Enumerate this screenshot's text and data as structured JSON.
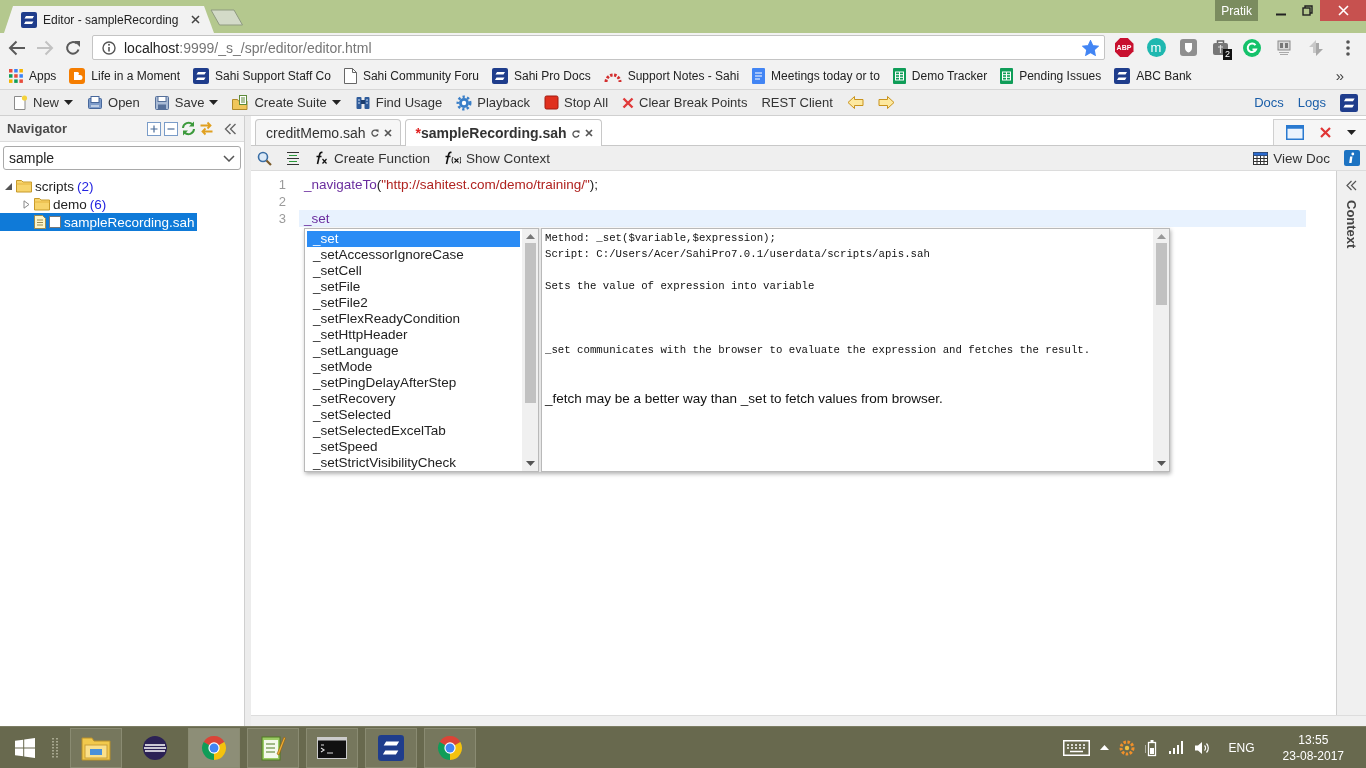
{
  "browser": {
    "tabs": [
      {
        "title": "Editor - sampleRecording",
        "selected": true
      }
    ],
    "profile_name": "Pratik",
    "nav_buttons": [
      {
        "kind": "back",
        "disabled": false
      },
      {
        "kind": "forward",
        "disabled": true
      },
      {
        "kind": "reload",
        "disabled": false
      }
    ],
    "address": {
      "host": "localhost",
      "rest": ":9999/_s_/spr/editor/editor.html",
      "bookmarked": true
    },
    "extensions": [
      {
        "kind": "stop-sign",
        "label": "ABP"
      },
      {
        "kind": "circle",
        "label": "m"
      },
      {
        "kind": "shield"
      },
      {
        "kind": "briefcase",
        "badge": "2"
      },
      {
        "kind": "g-circle"
      },
      {
        "kind": "box"
      },
      {
        "kind": "arrows"
      },
      {
        "kind": "menu"
      }
    ],
    "bookmarks": [
      {
        "kind": "apps",
        "label": "Apps"
      },
      {
        "kind": "blog",
        "label": "Life in a Moment"
      },
      {
        "kind": "logo",
        "label": "Sahi Support Staff Co"
      },
      {
        "kind": "page",
        "label": "Sahi Community Foru"
      },
      {
        "kind": "logo",
        "label": "Sahi Pro Docs"
      },
      {
        "kind": "arc",
        "label": "Support Notes - Sahi"
      },
      {
        "kind": "doc",
        "label": "Meetings today or to"
      },
      {
        "kind": "sheet",
        "label": "Demo Tracker"
      },
      {
        "kind": "sheet",
        "label": "Pending Issues"
      },
      {
        "kind": "logo",
        "label": "ABC Bank"
      }
    ],
    "bookmarks_overflow": "»"
  },
  "app_toolbar": {
    "items": [
      {
        "kind": "new",
        "label": "New",
        "dropdown": true
      },
      {
        "kind": "open",
        "label": "Open",
        "dropdown": false
      },
      {
        "kind": "save",
        "label": "Save",
        "dropdown": true
      },
      {
        "kind": "suite",
        "label": "Create Suite",
        "dropdown": true
      },
      {
        "kind": "find",
        "label": "Find Usage",
        "dropdown": false
      },
      {
        "kind": "playback",
        "label": "Playback",
        "dropdown": false
      },
      {
        "kind": "stop",
        "label": "Stop All",
        "dropdown": false
      },
      {
        "kind": "clear",
        "label": "Clear Break Points",
        "dropdown": false
      },
      {
        "kind": "rest",
        "label": "REST Client",
        "dropdown": false
      },
      {
        "kind": "back"
      },
      {
        "kind": "forward"
      }
    ],
    "links": [
      "Docs",
      "Logs"
    ]
  },
  "navigator": {
    "title": "Navigator",
    "filter": "sample",
    "tree": [
      {
        "kind": "folder",
        "label": "scripts",
        "count": "(2)",
        "expanded": true,
        "selected": false,
        "children": [
          {
            "kind": "folder",
            "label": "demo",
            "count": "(6)",
            "expanded": false,
            "selected": false
          },
          {
            "kind": "file",
            "label": "sampleRecording.sah",
            "selected": true
          }
        ]
      }
    ]
  },
  "editor": {
    "tabs": [
      {
        "title": "creditMemo.sah",
        "selected": false
      },
      {
        "modified_mark": "*",
        "title": "sampleRecording.sah",
        "selected": true
      }
    ],
    "toolbar": [
      {
        "kind": "search"
      },
      {
        "kind": "lines"
      },
      {
        "kind": "function",
        "label": "Create Function"
      },
      {
        "kind": "context",
        "label": "Show Context"
      }
    ],
    "toolbar_right": [
      {
        "kind": "doc",
        "label": "View Doc"
      },
      {
        "kind": "info"
      }
    ],
    "lines": [
      {
        "number": "1",
        "active": false,
        "tokens": [
          {
            "kind": "function",
            "text": "_navigateTo"
          },
          {
            "kind": "punct",
            "text": "("
          },
          {
            "kind": "string",
            "text": "\"http://sahitest.com/demo/training/\""
          },
          {
            "kind": "punct",
            "text": ");"
          }
        ]
      },
      {
        "number": "2",
        "active": false
      },
      {
        "number": "3",
        "active": true,
        "tokens": [
          {
            "kind": "function",
            "text": "_set"
          }
        ]
      }
    ],
    "autocomplete": {
      "suggestions": [
        {
          "label": "_set",
          "selected": true
        },
        {
          "label": "_setAccessorIgnoreCase",
          "selected": false
        },
        {
          "label": "_setCell",
          "selected": false
        },
        {
          "label": "_setFile",
          "selected": false
        },
        {
          "label": "_setFile2",
          "selected": false
        },
        {
          "label": "_setFlexReadyCondition",
          "selected": false
        },
        {
          "label": "_setHttpHeader",
          "selected": false
        },
        {
          "label": "_setLanguage",
          "selected": false
        },
        {
          "label": "_setMode",
          "selected": false
        },
        {
          "label": "_setPingDelayAfterStep",
          "selected": false
        },
        {
          "label": "_setRecovery",
          "selected": false
        },
        {
          "label": "_setSelected",
          "selected": false
        },
        {
          "label": "_setSelectedExcelTab",
          "selected": false
        },
        {
          "label": "_setSpeed",
          "selected": false
        },
        {
          "label": "_setStrictVisibilityCheck",
          "selected": false
        }
      ],
      "doc": [
        {
          "kind": "signature",
          "text": "Method: _set($variable,$expression);"
        },
        {
          "kind": "signature",
          "text": "Script: C:/Users/Acer/SahiPro7.0.1/userdata/scripts/apis.sah"
        },
        {
          "kind": "summary",
          "text": "Sets the value of expression into variable"
        },
        {
          "kind": "detail",
          "text": "_set communicates with the browser to evaluate the expression and fetches the result."
        },
        {
          "kind": "tip",
          "text": "_fetch may be a better way than _set to fetch values from browser."
        }
      ]
    },
    "side_panel": {
      "title": "Context"
    }
  },
  "taskbar": {
    "apps": [
      {
        "kind": "folder",
        "running": true,
        "selected": false
      },
      {
        "kind": "striped-circle",
        "running": false,
        "selected": false
      },
      {
        "kind": "browser",
        "running": true,
        "selected": true
      },
      {
        "kind": "notepad",
        "running": true,
        "selected": false
      },
      {
        "kind": "terminal",
        "running": true,
        "selected": false
      },
      {
        "kind": "logo",
        "running": true,
        "selected": false
      },
      {
        "kind": "browser",
        "running": true,
        "selected": false
      }
    ],
    "tray": {
      "language": "ENG",
      "time": "13:55",
      "date": "23-08-2017"
    }
  }
}
